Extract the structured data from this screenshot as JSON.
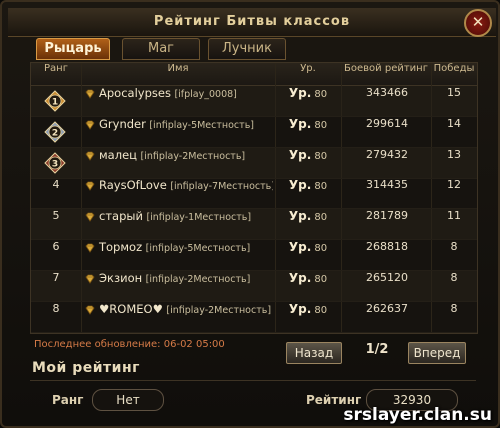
{
  "window": {
    "title": "Рейтинг Битвы классов",
    "close_symbol": "✕"
  },
  "tabs": [
    {
      "label": "Рыцарь",
      "active": true
    },
    {
      "label": "Маг",
      "active": false
    },
    {
      "label": "Лучник",
      "active": false
    }
  ],
  "table": {
    "headers": {
      "rank": "Ранг",
      "name": "Имя",
      "level": "Ур.",
      "rating": "Боевой рейтинг",
      "wins": "Победы"
    },
    "level_prefix": "Ур.",
    "rows": [
      {
        "rank": "1",
        "name": "Apocalypses",
        "server": "[ifplay_0008]",
        "level": "80",
        "rating": "343466",
        "wins": "15"
      },
      {
        "rank": "2",
        "name": "Grynder",
        "server": "[infiplay-5Местность]",
        "level": "80",
        "rating": "299614",
        "wins": "14"
      },
      {
        "rank": "3",
        "name": "малец",
        "server": "[infiplay-2Местность]",
        "level": "80",
        "rating": "279432",
        "wins": "13"
      },
      {
        "rank": "4",
        "name": "RaysOfLove",
        "server": "[infiplay-7Местность]",
        "level": "80",
        "rating": "314435",
        "wins": "12"
      },
      {
        "rank": "5",
        "name": "старый",
        "server": "[infiplay-1Местность]",
        "level": "80",
        "rating": "281789",
        "wins": "11"
      },
      {
        "rank": "6",
        "name": "Tормоz",
        "server": "[infiplay-5Местность]",
        "level": "80",
        "rating": "268818",
        "wins": "8"
      },
      {
        "rank": "7",
        "name": "Экзион",
        "server": "[infiplay-2Местность]",
        "level": "80",
        "rating": "265120",
        "wins": "8"
      },
      {
        "rank": "8",
        "name": "♥ROMEO♥",
        "server": "[infiplay-2Местность]",
        "level": "80",
        "rating": "262637",
        "wins": "8"
      }
    ]
  },
  "footer": {
    "last_update": "Последнее обновление: 06-02 05:00",
    "prev_label": "Назад",
    "page": "1/2",
    "next_label": "Вперед"
  },
  "my_rating": {
    "title": "Мой рейтинг",
    "rank_label": "Ранг",
    "rank_value": "Нет",
    "rating_label": "Рейтинг",
    "rating_value": "32930"
  },
  "watermark": "srslayer.clan.su",
  "colors": {
    "accent_tab": "#b06018",
    "update_text": "#d57b47",
    "gold_badge": "#c98a2e",
    "silver_badge": "#8a9bb5",
    "bronze_badge": "#8a3a2a"
  }
}
